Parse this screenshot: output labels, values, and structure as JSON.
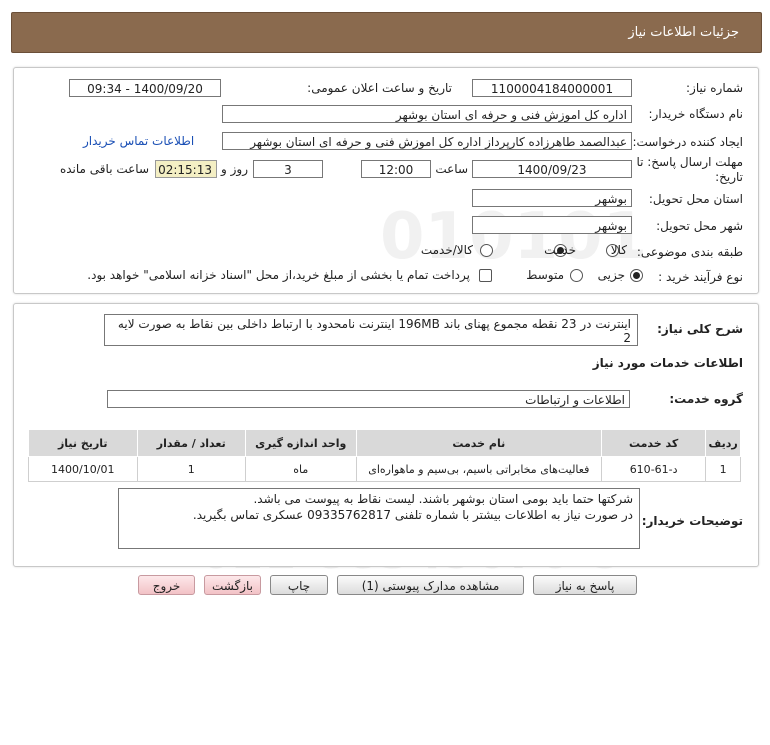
{
  "header": {
    "title": "جزئیات اطلاعات نیاز"
  },
  "info": {
    "need_number_label": "شماره نیاز:",
    "need_number": "1100004184000001",
    "announce_label": "تاریخ و ساعت اعلان عمومی:",
    "announce_value": "1400/09/20 - 09:34",
    "buyer_label": "نام دستگاه خریدار:",
    "buyer_value": "اداره کل اموزش فنی و حرفه ای استان بوشهر",
    "creator_label": "ایجاد کننده درخواست:",
    "creator_value": "عبدالصمد طاهرزاده کارپرداز اداره کل اموزش فنی و حرفه ای استان بوشهر",
    "contact_link": "اطلاعات تماس خریدار",
    "deadline_label_1": "مهلت ارسال پاسخ: تا",
    "deadline_label_2": "تاریخ:",
    "deadline_date": "1400/09/23",
    "time_label": "ساعت",
    "deadline_time": "12:00",
    "days_value": "3",
    "days_label": "روز و",
    "remaining_time": "02:15:13",
    "remaining_label": "ساعت باقی مانده",
    "province_label": "استان محل تحویل:",
    "province_value": "بوشهر",
    "city_label": "شهر محل تحویل:",
    "city_value": "بوشهر",
    "category_label": "طبقه بندی موضوعی:",
    "category_options": [
      "کالا",
      "خدمت",
      "کالا/خدمت"
    ],
    "category_selected": "خدمت",
    "process_label": "نوع فرآیند خرید :",
    "process_options": [
      "جزیی",
      "متوسط"
    ],
    "process_selected": "جزیی",
    "payment_note": "پرداخت تمام یا بخشی از مبلغ خرید،از محل \"اسناد خزانه اسلامی\" خواهد بود."
  },
  "general": {
    "desc_label": "شرح کلی نیاز:",
    "desc_value": "اینترنت در 23 نقطه مجموع پهنای باند 196MB اینترنت نامحدود با ارتباط داخلی بین نقاط به صورت لایه 2",
    "services_title": "اطلاعات خدمات مورد نیاز",
    "group_label": "گروه خدمت:",
    "group_value": "اطلاعات و ارتباطات"
  },
  "table": {
    "headers": [
      "ردیف",
      "کد خدمت",
      "نام خدمت",
      "واحد اندازه گیری",
      "تعداد / مقدار",
      "تاریخ نیاز"
    ],
    "rows": [
      [
        "1",
        "د-61-610",
        "فعالیت‌های مخابراتی باسیم، بی‌سیم و ماهواره‌ای",
        "ماه",
        "1",
        "1400/10/01"
      ]
    ]
  },
  "buyer_notes": {
    "label": "توضیحات خریدار:",
    "line1": "شرکتها حتما باید بومی استان بوشهر باشند. لیست نقاط به پیوست می باشد.",
    "line2": "در صورت نیاز به اطلاعات بیشتر با شماره تلفنی 09335762817 عسکری تماس بگیرید."
  },
  "buttons": {
    "reply": "پاسخ به نیاز",
    "attachments": "مشاهده مدارک پیوستی (1)",
    "print": "چاپ",
    "back": "بازگشت",
    "exit": "خروج"
  }
}
